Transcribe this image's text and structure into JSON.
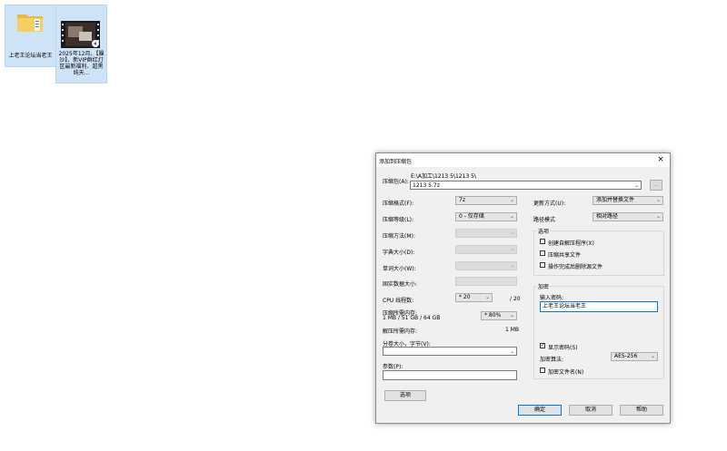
{
  "desktop": {
    "icons": [
      {
        "label": "上老王论坛当老王"
      },
      {
        "label": "2025年12月、【臊沙】、新VIP群红灯区最新福利、超黑纯天..."
      }
    ]
  },
  "dialog": {
    "title": "添加到压缩包",
    "close_glyph": "×",
    "archive": {
      "label": "压缩包(A):",
      "path": "E:\\A加工\\1213 5\\1213 5\\",
      "filename": "1213 5.7z",
      "browse_label": "..."
    },
    "left": {
      "format": {
        "label": "压缩格式(F):",
        "value": "7z"
      },
      "level": {
        "label": "压缩等级(L):",
        "value": "0 - 仅存储"
      },
      "method": {
        "label": "压缩方法(M):",
        "value": ""
      },
      "dict": {
        "label": "字典大小(D):",
        "value": ""
      },
      "word": {
        "label": "单词大小(W):",
        "value": ""
      },
      "solid": {
        "label": "固实数据大小:",
        "value": ""
      },
      "cpu": {
        "label": "CPU 线程数:",
        "value": "* 20",
        "max": "/ 20"
      },
      "mem": {
        "label": "压缩所需内存:",
        "detail": "1 MB / 51 GB / 64 GB",
        "value": "* 80%"
      },
      "decomp": {
        "label": "解压所需内存:",
        "value": "1 MB"
      },
      "split": {
        "label": "分卷大小，字节(V):",
        "value": ""
      },
      "params": {
        "label": "参数(P):",
        "value": ""
      },
      "options_button": "选项"
    },
    "right": {
      "update": {
        "label": "更新方式(U):",
        "value": "添加并替换文件"
      },
      "pathmode": {
        "label": "路径模式",
        "value": "相对路径"
      },
      "options": {
        "title": "选项",
        "items": [
          {
            "label": "创建自解压程序(X)",
            "checked": false
          },
          {
            "label": "压缩共享文件",
            "checked": false
          },
          {
            "label": "操作完成后删除源文件",
            "checked": false
          }
        ]
      },
      "encryption": {
        "title": "加密",
        "password_label": "输入密码:",
        "password_value": "上老王论坛当老王",
        "show_password": {
          "label": "显示密码(S)",
          "checked": true
        },
        "method_label": "加密算法:",
        "method_value": "AES-256",
        "encrypt_names": {
          "label": "加密文件名(N)",
          "checked": false
        }
      }
    },
    "buttons": {
      "ok": "确定",
      "cancel": "取消",
      "help": "帮助"
    }
  }
}
